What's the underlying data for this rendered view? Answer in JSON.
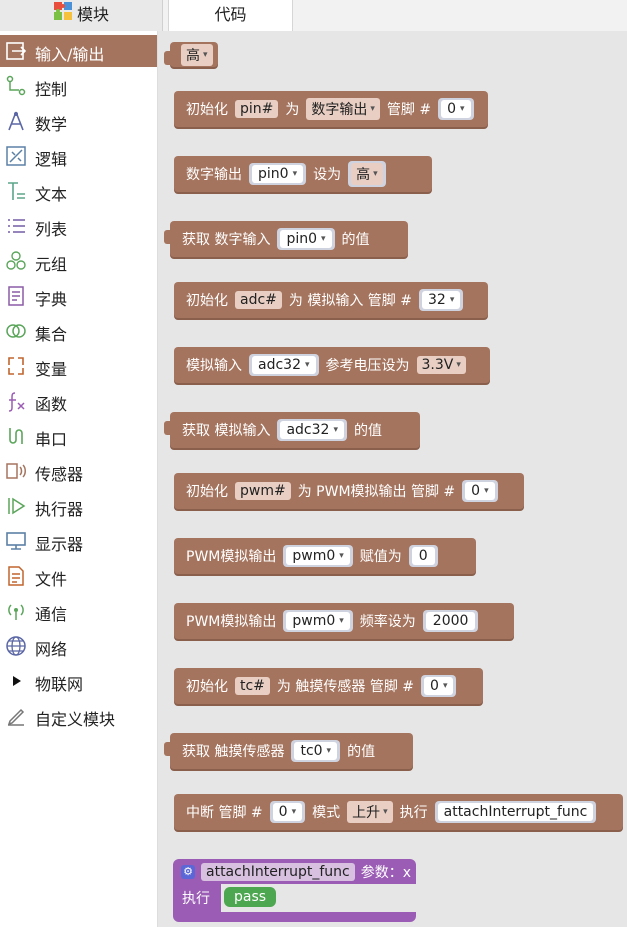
{
  "tabs": {
    "modules": "模块",
    "code": "代码"
  },
  "sidebar": {
    "items": [
      {
        "label": "输入/输出",
        "icon": "io-icon",
        "color": "#a5745e"
      },
      {
        "label": "控制",
        "icon": "control-icon",
        "color": "#5ba55b"
      },
      {
        "label": "数学",
        "icon": "math-icon",
        "color": "#5b67a5"
      },
      {
        "label": "逻辑",
        "icon": "logic-icon",
        "color": "#5b80a5"
      },
      {
        "label": "文本",
        "icon": "text-icon",
        "color": "#5ba58c"
      },
      {
        "label": "列表",
        "icon": "list-icon",
        "color": "#745ba5"
      },
      {
        "label": "元组",
        "icon": "tuple-icon",
        "color": "#5ba55b"
      },
      {
        "label": "字典",
        "icon": "dict-icon",
        "color": "#8c5ba5"
      },
      {
        "label": "集合",
        "icon": "set-icon",
        "color": "#5ba55b"
      },
      {
        "label": "变量",
        "icon": "variable-icon",
        "color": "#c0652e"
      },
      {
        "label": "函数",
        "icon": "function-icon",
        "color": "#9a5cb4"
      },
      {
        "label": "串口",
        "icon": "serial-icon",
        "color": "#5ba55b"
      },
      {
        "label": "传感器",
        "icon": "sensor-icon",
        "color": "#a5745e"
      },
      {
        "label": "执行器",
        "icon": "actuator-icon",
        "color": "#5ba55b"
      },
      {
        "label": "显示器",
        "icon": "display-icon",
        "color": "#5b80a5"
      },
      {
        "label": "文件",
        "icon": "file-icon",
        "color": "#c0652e"
      },
      {
        "label": "通信",
        "icon": "comm-icon",
        "color": "#5ba55b"
      },
      {
        "label": "网络",
        "icon": "network-icon",
        "color": "#5b67a5"
      },
      {
        "label": "物联网",
        "icon": "iot-icon",
        "color": "#111111"
      },
      {
        "label": "自定义模块",
        "icon": "custom-icon",
        "color": "#777777"
      }
    ]
  },
  "blocks": {
    "b0": {
      "value": "高"
    },
    "b1": {
      "t1": "初始化",
      "pin": "pin#",
      "t2": "为",
      "mode": "数字输出",
      "t3": "管脚 #",
      "num": "0"
    },
    "b2": {
      "t1": "数字输出",
      "pin": "pin0",
      "t2": "设为",
      "val": "高"
    },
    "b3": {
      "t1": "获取  数字输入",
      "pin": "pin0",
      "t2": "的值"
    },
    "b4": {
      "t1": "初始化",
      "pin": "adc#",
      "t2": "为  模拟输入  管脚 #",
      "num": "32"
    },
    "b5": {
      "t1": "模拟输入",
      "pin": "adc32",
      "t2": "参考电压设为",
      "val": "3.3V"
    },
    "b6": {
      "t1": "获取  模拟输入",
      "pin": "adc32",
      "t2": "的值"
    },
    "b7": {
      "t1": "初始化",
      "pin": "pwm#",
      "t2": "为  PWM模拟输出  管脚 #",
      "num": "0"
    },
    "b8": {
      "t1": "PWM模拟输出",
      "pin": "pwm0",
      "t2": "赋值为",
      "num": "0"
    },
    "b9": {
      "t1": "PWM模拟输出",
      "pin": "pwm0",
      "t2": "频率设为",
      "num": "2000"
    },
    "b10": {
      "t1": "初始化",
      "pin": "tc#",
      "t2": "为  触摸传感器  管脚 #",
      "num": "0"
    },
    "b11": {
      "t1": "获取  触摸传感器",
      "pin": "tc0",
      "t2": "的值"
    },
    "b12": {
      "t1": "中断 管脚 #",
      "num": "0",
      "t2": "模式",
      "mode": "上升",
      "t3": "执行",
      "func": "attachInterrupt_func"
    },
    "fn": {
      "name": "attachInterrupt_func",
      "params": "参数：x",
      "exec": "执行",
      "pass": "pass"
    }
  }
}
